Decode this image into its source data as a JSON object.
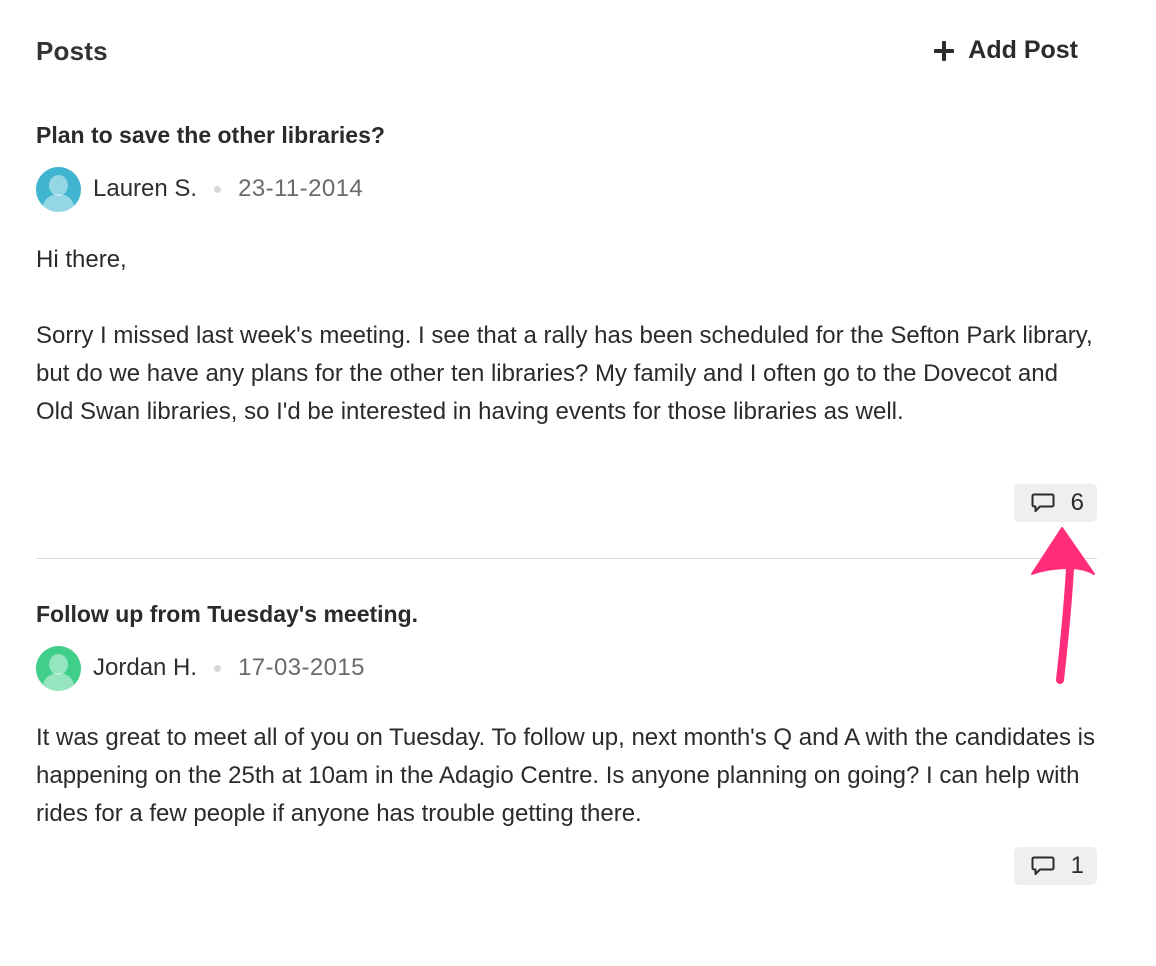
{
  "header": {
    "title": "Posts",
    "add_post_label": "Add Post"
  },
  "posts": [
    {
      "title": "Plan to save the other libraries?",
      "author": "Lauren S.",
      "date": "23-11-2014",
      "avatar_color": "#3fb5cf",
      "body": [
        "Hi there,",
        "Sorry I missed last week's meeting. I see that a rally has been scheduled for the Sefton Park library, but do we have any plans for the other ten libraries? My family and I often go to the Dovecot and Old Swan libraries, so I'd be interested in having events for those libraries as well."
      ],
      "comment_count": "6"
    },
    {
      "title": "Follow up from Tuesday's meeting.",
      "author": "Jordan H.",
      "date": "17-03-2015",
      "avatar_color": "#3fcf8a",
      "body": [
        "It was great to meet all of you on Tuesday. To follow up, next month's Q and A with the candidates is happening on the 25th at 10am in the Adagio Centre. Is anyone planning on going? I can help with rides for a few people if anyone has trouble getting there."
      ],
      "comment_count": "1"
    }
  ],
  "annotation": {
    "arrow_color": "#ff2d7a",
    "arrow_target": "comment-count-button"
  }
}
